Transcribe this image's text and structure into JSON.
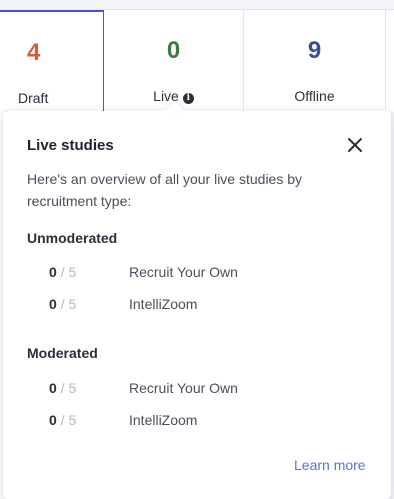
{
  "stats": {
    "draft": {
      "count": "4",
      "label": "Draft"
    },
    "live": {
      "count": "0",
      "label": "Live"
    },
    "offline": {
      "count": "9",
      "label": "Offline"
    }
  },
  "popover": {
    "title": "Live studies",
    "description": "Here's an overview of all your live studies by recruitment type:",
    "sections": [
      {
        "title": "Unmoderated",
        "rows": [
          {
            "count": "0",
            "separator": "/",
            "max": "5",
            "type": "Recruit Your Own"
          },
          {
            "count": "0",
            "separator": "/",
            "max": "5",
            "type": "IntelliZoom"
          }
        ]
      },
      {
        "title": "Moderated",
        "rows": [
          {
            "count": "0",
            "separator": "/",
            "max": "5",
            "type": "Recruit Your Own"
          },
          {
            "count": "0",
            "separator": "/",
            "max": "5",
            "type": "IntelliZoom"
          }
        ]
      }
    ],
    "learn_more": "Learn more"
  },
  "icons": {
    "info": "info-icon",
    "close": "close-icon"
  },
  "colors": {
    "draft": "#d75b3f",
    "live": "#3e7a46",
    "offline": "#3d4aa2",
    "link": "#5a72d6",
    "active_border": "#4a55c8"
  }
}
